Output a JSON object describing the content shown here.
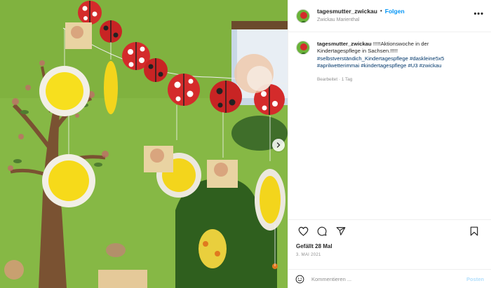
{
  "post": {
    "username": "tagesmutter_zwickau",
    "separator": "•",
    "follow_label": "Folgen",
    "location": "Zwickau Marienthal",
    "more_label": "•••"
  },
  "caption": {
    "username": "tagesmutter_zwickau",
    "text": " !!!!!Aktionswoche in der Kindertagespflege in Sachsen.!!!!!",
    "hashtags": [
      "#selbstverständich_Kindertagespflege",
      "#daskleine5x5",
      "#aprilwetterimmai",
      "#kindertagespflege",
      "#U3",
      "#zwickau"
    ],
    "edited": "Bearbeitet",
    "separator": "·",
    "age": "1 Tag"
  },
  "engagement": {
    "likes": "Gefällt 28 Mal",
    "date": "3. MAI 2021"
  },
  "comment": {
    "placeholder": "Kommentieren ...",
    "post_label": "Posten"
  },
  "icons": {
    "like": "heart-icon",
    "comment": "comment-icon",
    "share": "share-icon",
    "save": "bookmark-icon",
    "emoji": "emoji-icon",
    "next": "chevron-right-icon"
  },
  "colors": {
    "link": "#0095f6",
    "hashtag": "#00376b",
    "muted": "#8e8e8e",
    "post_disabled": "#b2dffc"
  }
}
